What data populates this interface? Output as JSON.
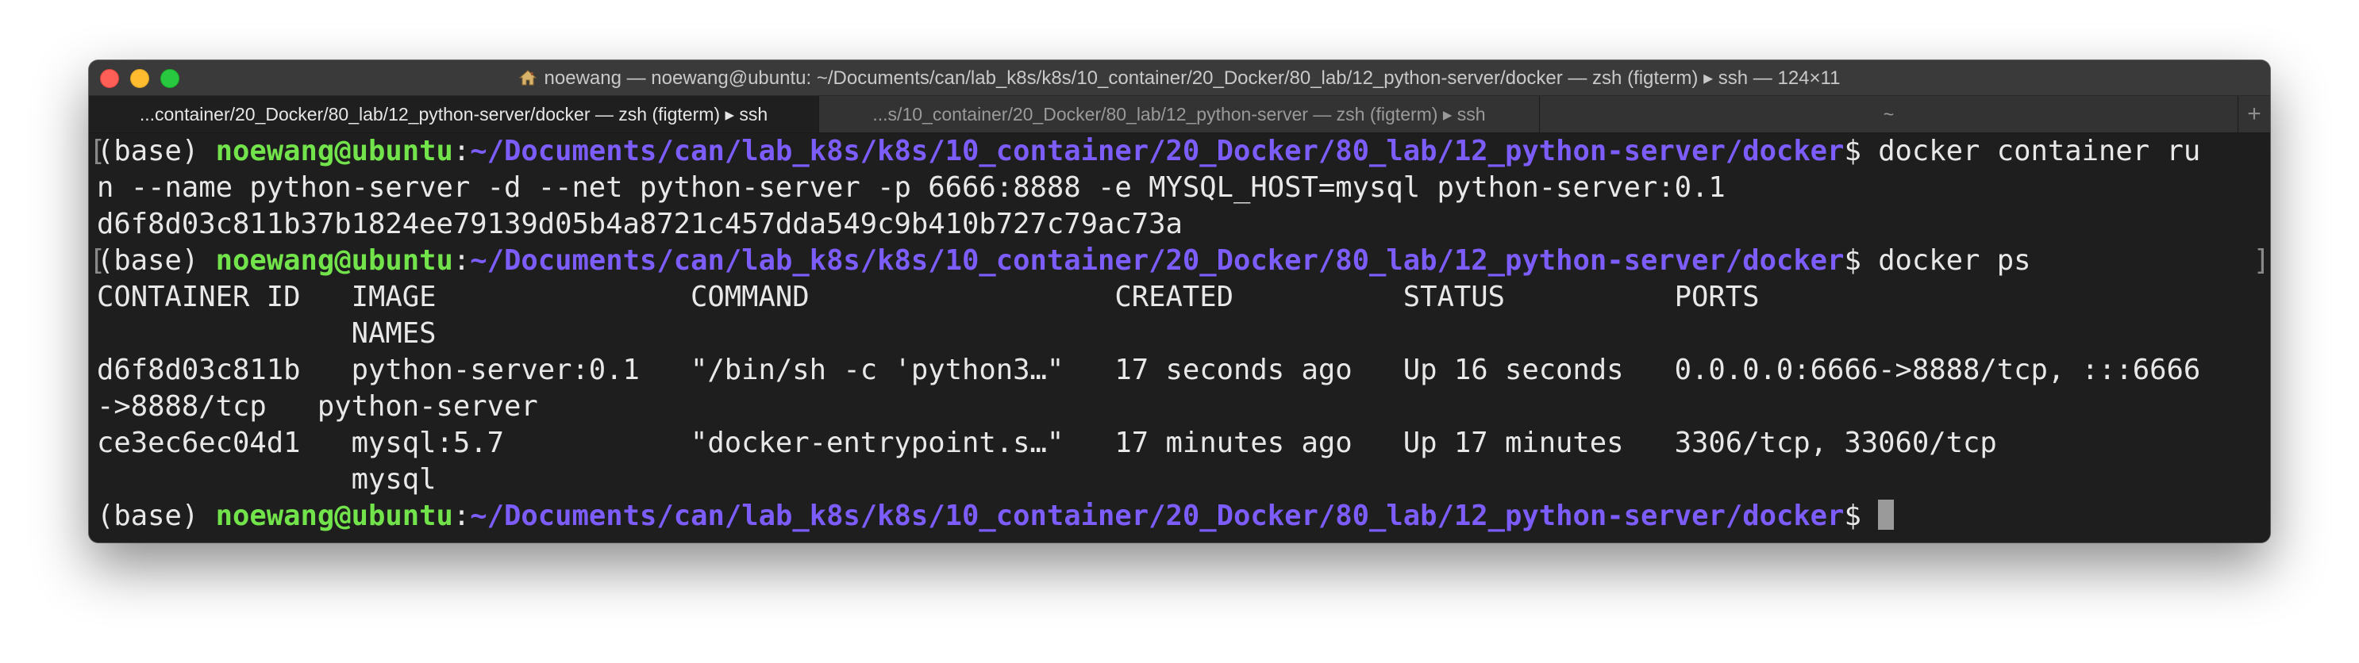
{
  "window": {
    "title": "noewang — noewang@ubuntu: ~/Documents/can/lab_k8s/k8s/10_container/20_Docker/80_lab/12_python-server/docker — zsh (figterm) ▸ ssh — 124×11",
    "title_icon": "home-icon"
  },
  "tabs": [
    {
      "label": "...container/20_Docker/80_lab/12_python-server/docker — zsh (figterm) ▸ ssh",
      "active": true
    },
    {
      "label": "...s/10_container/20_Docker/80_lab/12_python-server — zsh (figterm) ▸ ssh",
      "active": false
    },
    {
      "label": "~",
      "active": false
    }
  ],
  "new_tab_label": "+",
  "prompt": {
    "env": "(base) ",
    "user_host": "noewang@ubuntu",
    "sep": ":",
    "path": "~/Documents/can/lab_k8s/k8s/10_container/20_Docker/80_lab/12_python-server/docker",
    "symbol": "$ "
  },
  "commands": {
    "run_part1": "docker container ru",
    "run_part2": "n --name python-server -d --net python-server -p 6666:8888 -e MYSQL_HOST=mysql python-server:0.1",
    "run_output": "d6f8d03c811b37b1824ee79139d05b4a8721c457dda549c9b410b727c79ac73a",
    "ps": "docker ps"
  },
  "ps_output": {
    "header_line1": "CONTAINER ID   IMAGE               COMMAND                  CREATED          STATUS          PORTS",
    "header_line2": "               NAMES",
    "row1_line1": "d6f8d03c811b   python-server:0.1   \"/bin/sh -c 'python3…\"   17 seconds ago   Up 16 seconds   0.0.0.0:6666->8888/tcp, :::6666",
    "row1_line2": "->8888/tcp   python-server",
    "row2_line1": "ce3ec6ec04d1   mysql:5.7           \"docker-entrypoint.s…\"   17 minutes ago   Up 17 minutes   3306/tcp, 33060/tcp",
    "row2_line2": "               mysql"
  },
  "colors": {
    "user": "#72e34b",
    "path": "#7c5dfa",
    "background": "#1e1e1e",
    "text": "#e8e8e8"
  }
}
